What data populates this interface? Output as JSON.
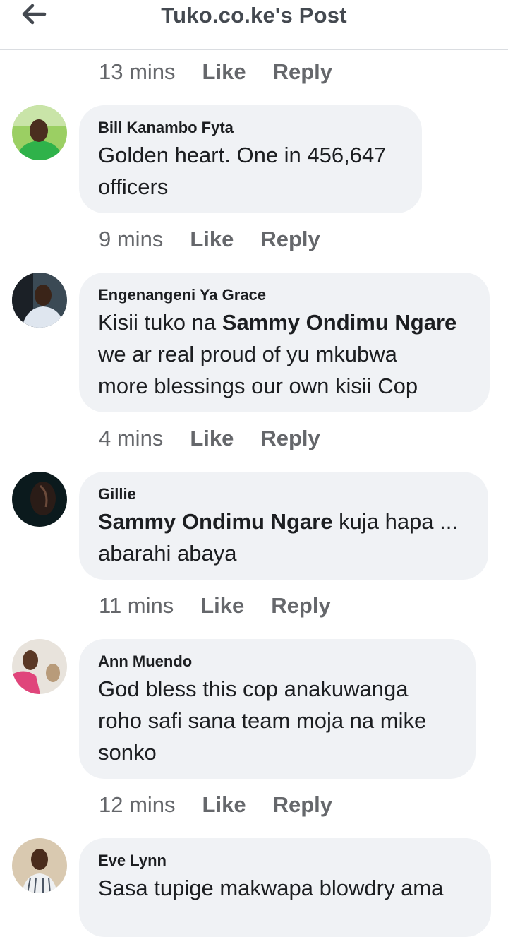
{
  "header": {
    "title": "Tuko.co.ke's Post",
    "back_icon": "arrow-left-icon"
  },
  "actions_labels": {
    "like": "Like",
    "reply": "Reply"
  },
  "top_action_row": {
    "time": "13 mins"
  },
  "comments": [
    {
      "author": "Bill Kanambo Fyta",
      "lines": [
        {
          "text": "Golden heart. One in 456,647"
        },
        {
          "text": "officers"
        }
      ],
      "time": "9 mins"
    },
    {
      "author": "Engenangeni Ya Grace",
      "lines": [
        {
          "prefix": "Kisii tuko na ",
          "mention": "Sammy Ondimu Ngare"
        },
        {
          "text": "we ar real proud of yu mkubwa"
        },
        {
          "text": "more blessings our own kisii Cop"
        }
      ],
      "time": "4 mins"
    },
    {
      "author": "Gillie",
      "lines": [
        {
          "mention": "Sammy Ondimu Ngare",
          "suffix": " kuja hapa ..."
        },
        {
          "text": "abarahi abaya"
        }
      ],
      "time": "11 mins"
    },
    {
      "author": "Ann Muendo",
      "lines": [
        {
          "text": "God bless this cop anakuwanga"
        },
        {
          "text": "roho safi sana team moja na mike"
        },
        {
          "text": "sonko"
        }
      ],
      "time": "12 mins"
    },
    {
      "author": "Eve Lynn",
      "lines": [
        {
          "text": "Sasa tupige makwapa blowdry ama"
        }
      ]
    }
  ]
}
